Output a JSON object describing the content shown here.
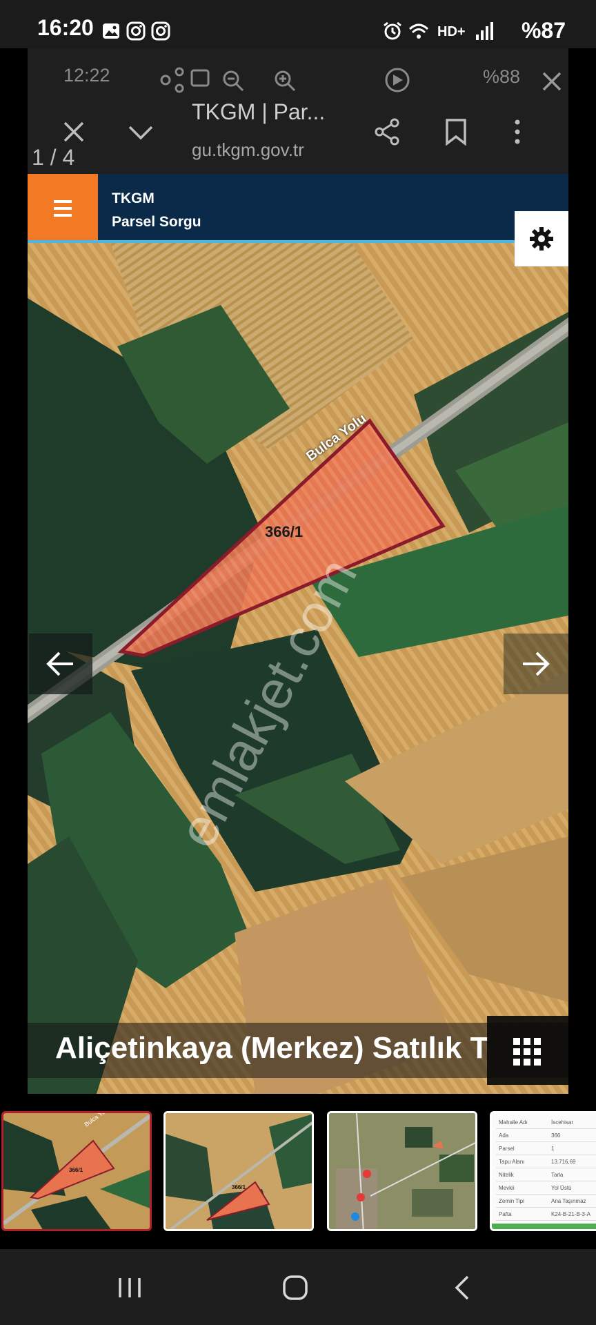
{
  "status_bar": {
    "time": "16:20",
    "icons": [
      "gallery-icon",
      "instagram-icon",
      "instagram-icon",
      "alarm-icon",
      "wifi-icon",
      "hd-plus-icon",
      "signal-icon"
    ],
    "battery": "%87"
  },
  "inner_status": {
    "time": "12:22",
    "battery": "%88"
  },
  "viewer": {
    "page_counter": "1 / 4"
  },
  "browser": {
    "tab_title": "TKGM | Par...",
    "url": "gu.tkgm.gov.tr"
  },
  "tkgm": {
    "title": "TKGM",
    "subtitle": "Parsel Sorgu",
    "accent": "#f27a25",
    "header_bg": "#0b2a4a"
  },
  "map": {
    "road_label": "Bulca Yolu",
    "parcel_label": "366/1",
    "watermark": "emlakjet.com",
    "parcel_fill": "#e8734f",
    "parcel_stroke": "#8b1a2b"
  },
  "caption": {
    "text": "Aliçetinkaya (Merkez) Satılık T"
  },
  "thumbnails": {
    "t1_label": "366/1",
    "t2_label": "366/1",
    "t4_rows": [
      {
        "key": "Mahalle Adı",
        "value": "İscehisar"
      },
      {
        "key": "Ada",
        "value": "366"
      },
      {
        "key": "Parsel",
        "value": "1"
      },
      {
        "key": "Tapu Alanı",
        "value": "13.716,69"
      },
      {
        "key": "Nitelik",
        "value": "Tarla"
      },
      {
        "key": "Mevkii",
        "value": "Yol Üstü"
      },
      {
        "key": "Zemin Tipi",
        "value": "Ana Taşınmaz"
      },
      {
        "key": "Pafta",
        "value": "K24-B-21-B-3-A"
      }
    ]
  }
}
